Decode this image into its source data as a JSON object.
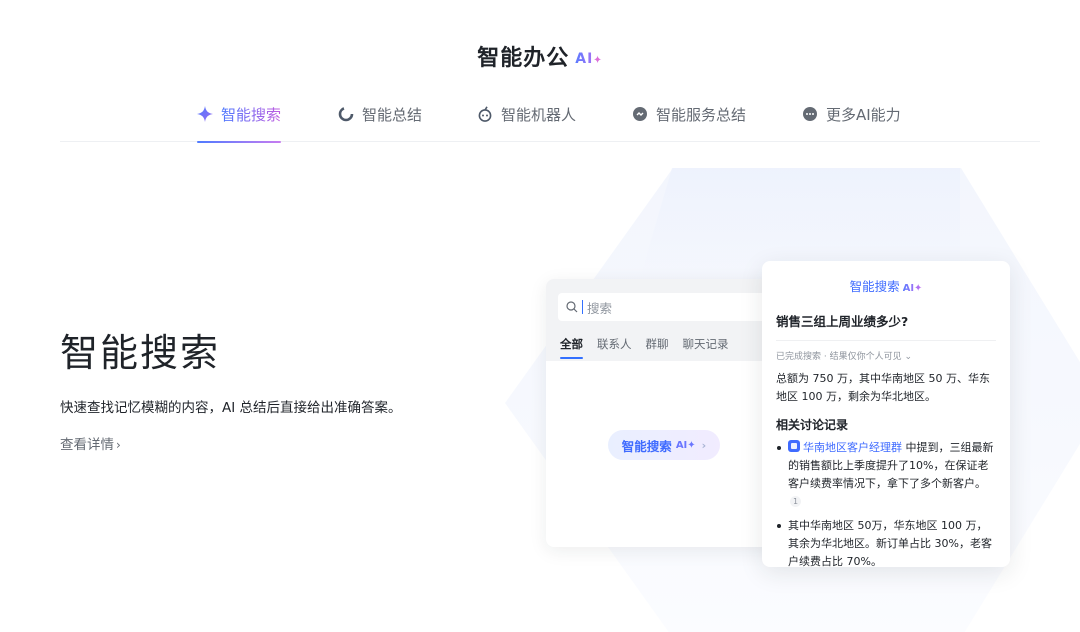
{
  "header": {
    "title": "智能办公",
    "ai_badge": "AI",
    "sparkle": "✦"
  },
  "tabs": [
    {
      "label": "智能搜索",
      "icon": "sparkle-icon",
      "active": true
    },
    {
      "label": "智能总结",
      "icon": "summary-ring-icon",
      "active": false
    },
    {
      "label": "智能机器人",
      "icon": "robot-icon",
      "active": false
    },
    {
      "label": "智能服务总结",
      "icon": "chat-bubble-icon",
      "active": false
    },
    {
      "label": "更多AI能力",
      "icon": "more-dots-icon",
      "active": false
    }
  ],
  "hero": {
    "title": "智能搜索",
    "description": "快速查找记忆模糊的内容，AI 总结后直接给出准确答案。",
    "link_label": "查看详情",
    "link_chevron": "›"
  },
  "search_card": {
    "placeholder": "搜索",
    "tabs": [
      {
        "label": "全部",
        "active": true
      },
      {
        "label": "联系人",
        "active": false
      },
      {
        "label": "群聊",
        "active": false
      },
      {
        "label": "聊天记录",
        "active": false
      }
    ],
    "ai_button_label": "智能搜索",
    "ai_button_badge": "AI✦",
    "ai_button_chevron": "›"
  },
  "result_card": {
    "header": "智能搜索",
    "header_badge": "AI✦",
    "question": "销售三组上周业绩多少?",
    "meta": "已完成搜索 · 结果仅你个人可见 ⌄",
    "answer": "总额为 750 万，其中华南地区 50 万、华东地区 100 万，剩余为华北地区。",
    "section_title": "相关讨论记录",
    "items": [
      {
        "group_name": "华南地区客户经理群",
        "text": " 中提到，三组最新的销售额比上季度提升了10%，在保证老客户续费率情况下，拿下了多个新客户。",
        "cite": "1"
      },
      {
        "text": "其中华南地区 50万，华东地区 100 万，其余为华北地区。新订单占比 30%，老客户续费占比 70%。"
      }
    ]
  },
  "colors": {
    "accent": "#3f6bff",
    "gradient_start": "#4f7bff",
    "gradient_end": "#c77cf0",
    "text_primary": "#1f2329",
    "text_secondary": "#646a73"
  }
}
